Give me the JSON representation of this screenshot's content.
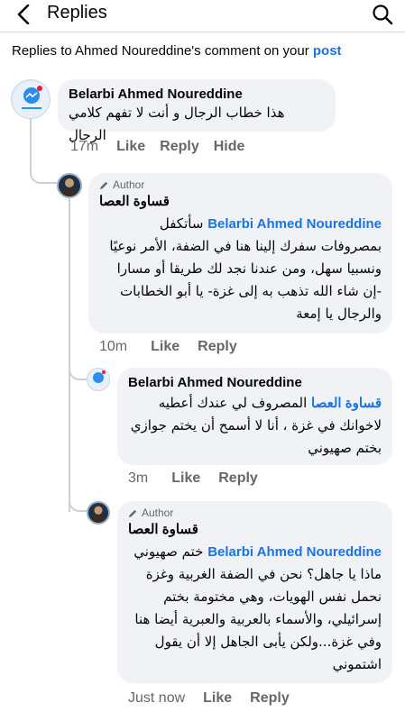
{
  "header": {
    "title": "Replies",
    "back_icon": "chevron-left-icon",
    "search_icon": "search-icon"
  },
  "context": {
    "prefix": "Replies to Ahmed Noureddine's comment on your ",
    "link": "post"
  },
  "comments": [
    {
      "author": "Belarbi Ahmed Noureddine",
      "is_author": false,
      "mention": "",
      "text": "هذا خطاب الرجال و أنت لا تفهم كلامي الرجال",
      "time": "17m",
      "like": "Like",
      "reply": "Reply",
      "hide": "Hide"
    },
    {
      "author": "قساوة العصا",
      "is_author": true,
      "badge": "Author",
      "mention": "Belarbi Ahmed Noureddine",
      "text": "سأتكفل بمصروفات سفرك إلينا هنا في الضفة، الأمر نوعيًا ونسبيا سهل، ومن عندنا نجد لك طريقا أو مسارا -إن شاء الله تذهب به إلى غزة- يا أبو الخطابات والرجال يا إمعة",
      "time": "10m",
      "like": "Like",
      "reply": "Reply"
    },
    {
      "author": "Belarbi Ahmed Noureddine",
      "is_author": false,
      "mention": "قساوة العصا",
      "text": "المصروف لي عندك أعطيه لاخوانك في غزة ، أنا لا أسمح أن يختم جوازي بختم صهيوني",
      "time": "3m",
      "like": "Like",
      "reply": "Reply"
    },
    {
      "author": "قساوة العصا",
      "is_author": true,
      "badge": "Author",
      "mention": "Belarbi Ahmed Noureddine",
      "text": "ختم صهيوني ماذا يا جاهل؟ نحن في الضفة الغربية وغزة نحمل نفس الهويات، وهي مختومة بختم إسرائيلي، والأسماء بالعربية والعبرية أيضا هنا وفي غزة...ولكن يأبى الجاهل إلا أن يقول اشتموني",
      "time": "Just now",
      "like": "Like",
      "reply": "Reply"
    }
  ]
}
